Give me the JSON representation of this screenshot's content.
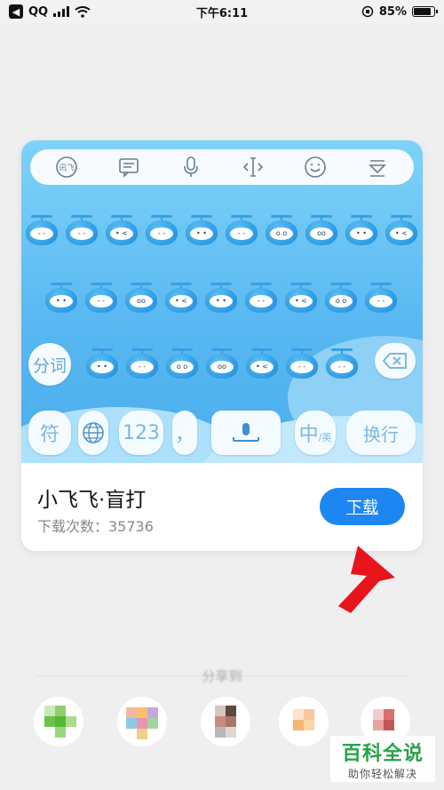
{
  "status_bar": {
    "back_app": "QQ",
    "time": "下午6:11",
    "battery_text": "85%",
    "battery_level": 0.85
  },
  "keyboard_preview": {
    "toolbar_icons": [
      "ime-logo-icon",
      "chat-bubble-icon",
      "microphone-icon",
      "cursor-move-icon",
      "smiley-icon",
      "keyboard-hide-icon"
    ],
    "keys": {
      "fenci": "分词",
      "symbol": "符",
      "number": "123",
      "punct": "，",
      "zh": "中",
      "zh_sub": "/英",
      "enter": "换行"
    },
    "emoji_faces_row1": [
      "- -",
      "- -",
      "• <",
      "- -",
      "• •",
      "- -",
      "o o",
      "oo",
      "• •",
      "• <"
    ],
    "emoji_faces_row2": [
      "• •",
      "- -",
      "oo",
      "• <",
      "• •",
      "- -",
      "• <",
      "o o",
      "- -"
    ],
    "emoji_faces_row3": [
      "• •",
      "- -",
      "o o",
      "oo",
      "• <",
      "- -",
      "- -"
    ]
  },
  "app_info": {
    "name": "小飞飞·盲打",
    "download_count": "下载次数：35736",
    "download_button": "下载"
  },
  "share": {
    "label": "分享到"
  },
  "watermark": {
    "title": "百科全说",
    "subtitle": "助你轻松解决"
  },
  "colors": {
    "accent": "#1d86f0",
    "arrow": "#e8141c",
    "keyboard_bg": "#57b7f1"
  }
}
